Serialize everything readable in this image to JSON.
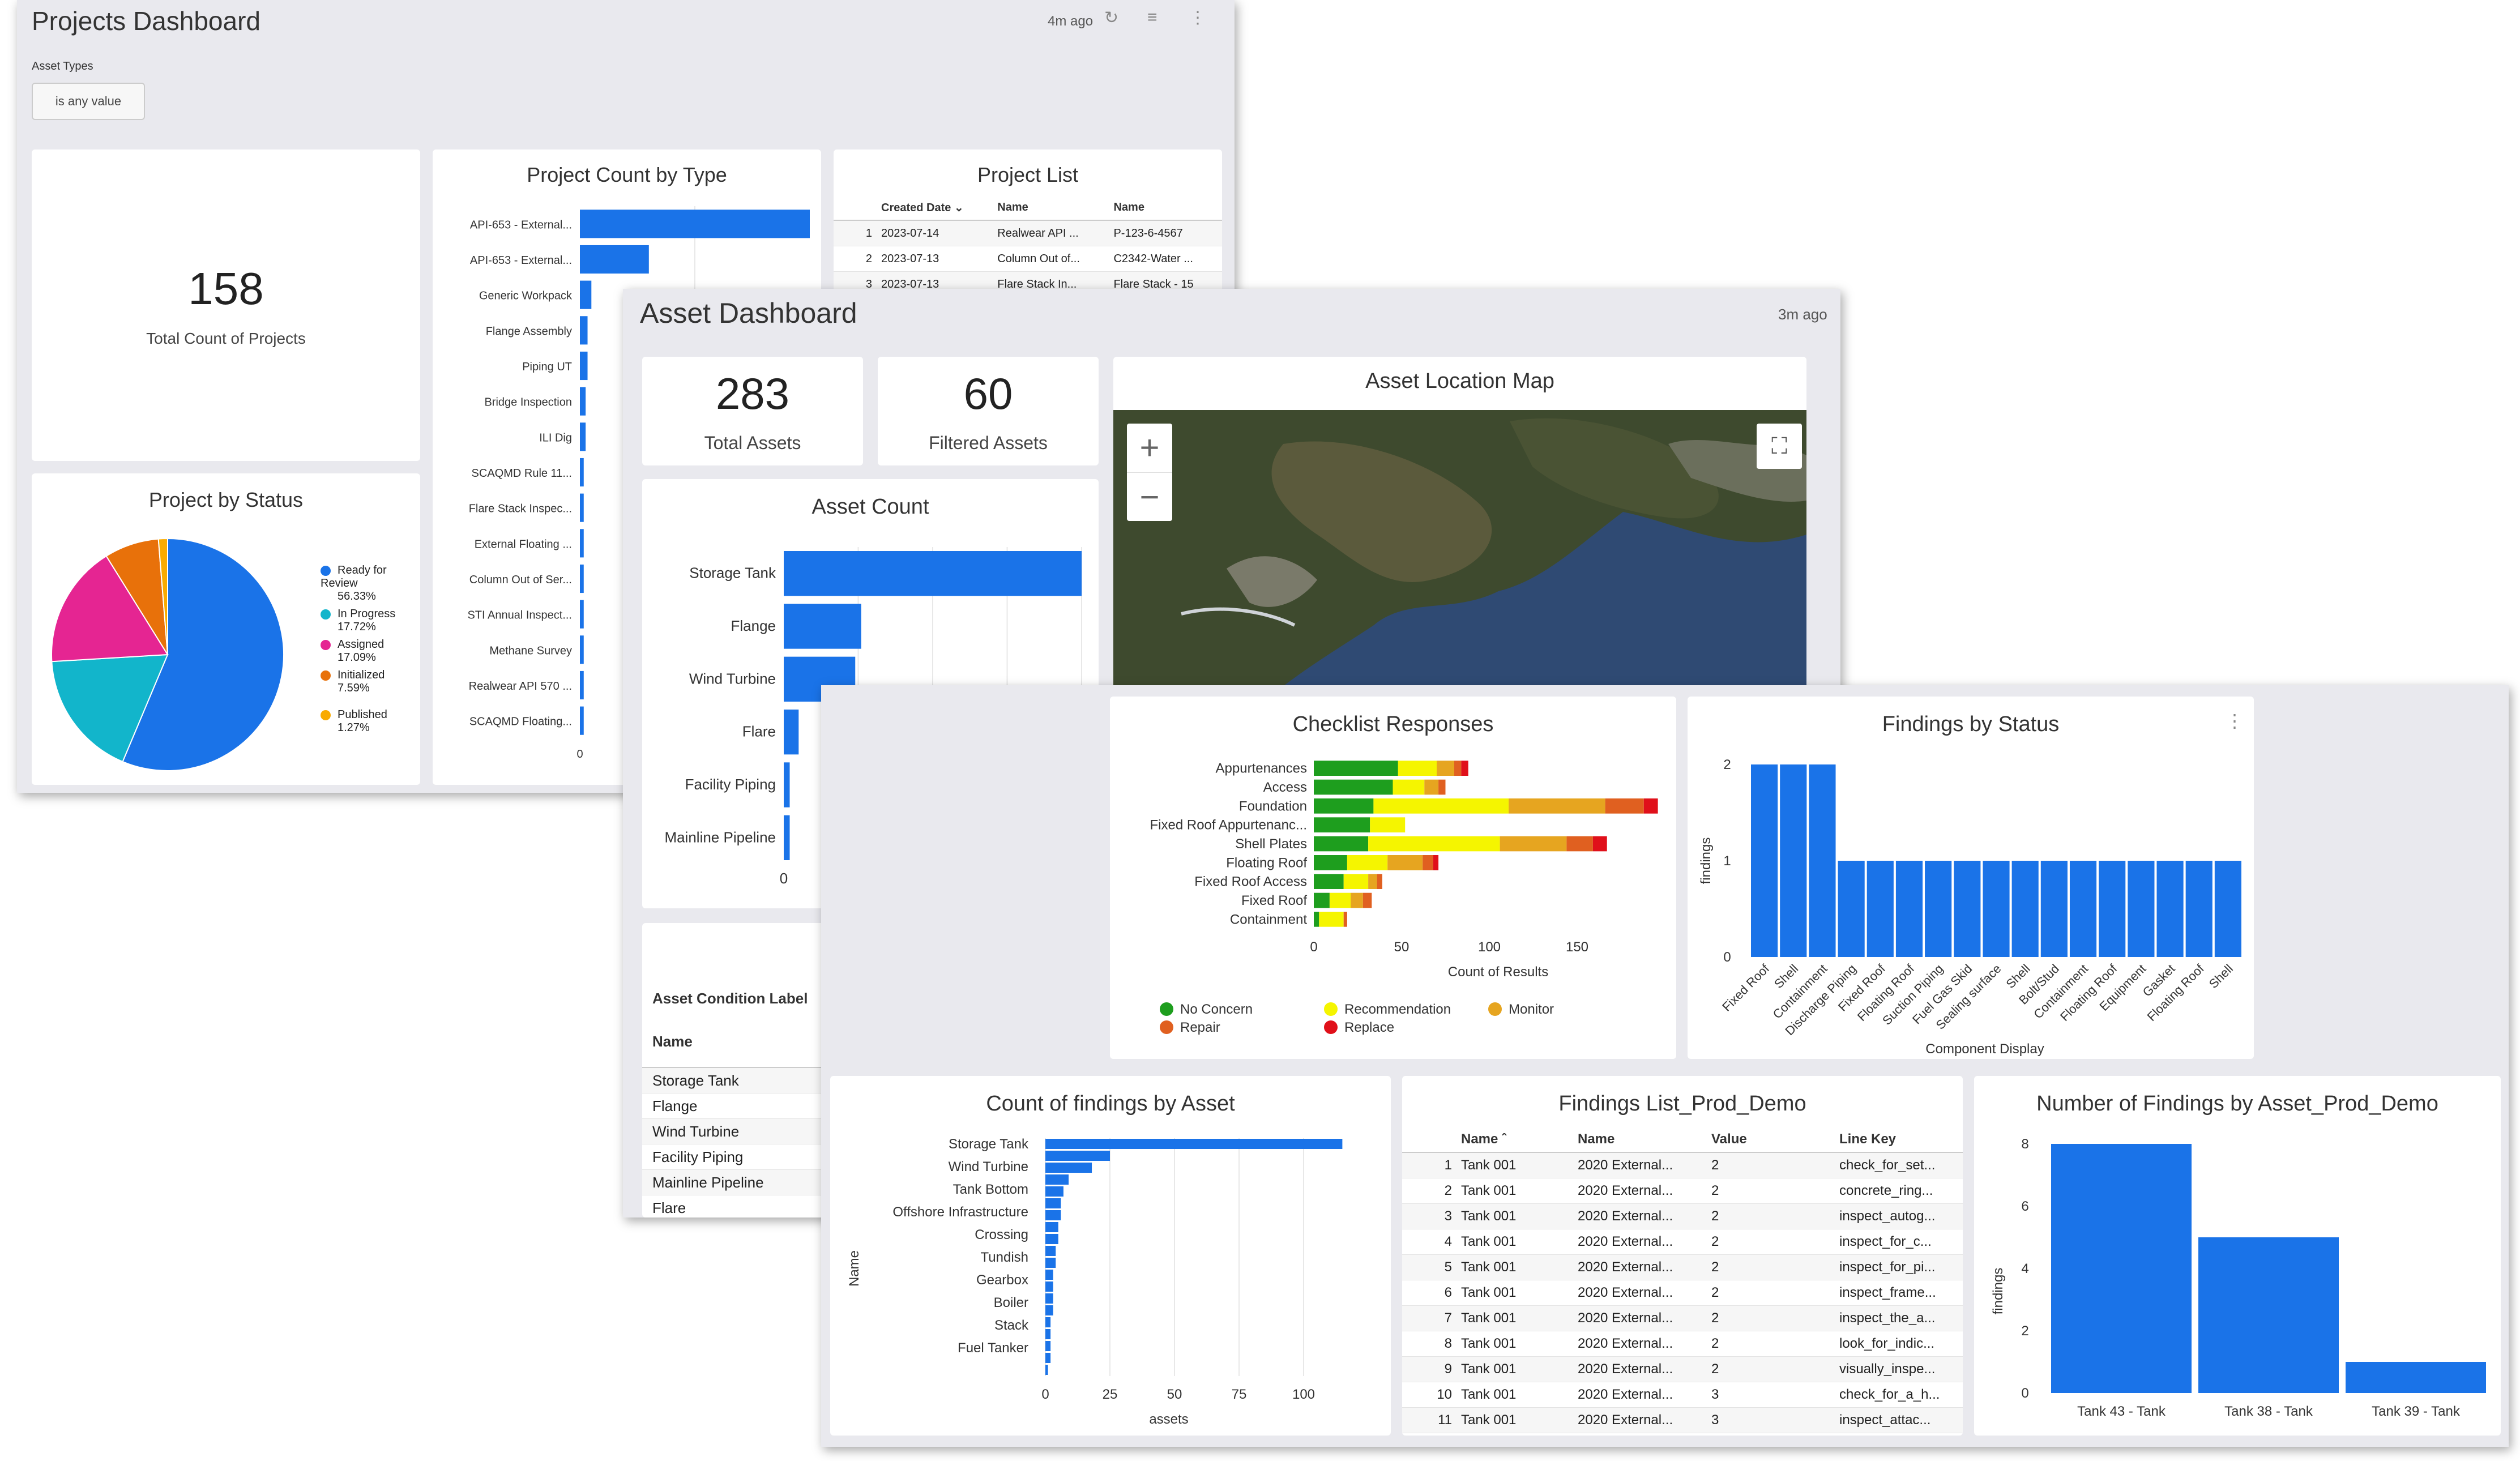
{
  "projects": {
    "title": "Projects Dashboard",
    "updated": "4m ago",
    "filter_label": "Asset Types",
    "filter_value": "is any value",
    "total_count": "158",
    "total_label": "Total Count of Projects",
    "count_by_type": {
      "title": "Project Count by Type",
      "categories": [
        "API-653 - External...",
        "API-653 - External...",
        "Generic Workpack",
        "Flange Assembly",
        "Piping UT",
        "Bridge Inspection",
        "ILI Dig",
        "SCAQMD Rule 11...",
        "Flare Stack Inspec...",
        "External Floating ...",
        "Column Out of Ser...",
        "STI Annual Inspect...",
        "Methane Survey",
        "Realwear API 570 ...",
        "SCAQMD Floating..."
      ],
      "values": [
        60,
        18,
        3,
        2,
        2,
        1.5,
        1.5,
        1,
        1,
        1,
        1,
        1,
        1,
        1,
        1
      ],
      "x_tick": "0"
    },
    "project_list": {
      "title": "Project List",
      "headers": [
        "Created Date",
        "Name",
        "Name"
      ],
      "rows": [
        [
          "1",
          "2023-07-14",
          "Realwear API ...",
          "P-123-6-4567"
        ],
        [
          "2",
          "2023-07-13",
          "Column Out of...",
          "C2342-Water ..."
        ],
        [
          "3",
          "2023-07-13",
          "Flare Stack In...",
          "Flare Stack - 15"
        ]
      ]
    },
    "by_status": {
      "title": "Project by Status",
      "legend": [
        {
          "label": "Ready for Review",
          "pct": "56.33%",
          "color": "#1a73e8",
          "value": 56.33
        },
        {
          "label": "In Progress",
          "pct": "17.72%",
          "color": "#12b5cb",
          "value": 17.72
        },
        {
          "label": "Assigned",
          "pct": "17.09%",
          "color": "#e52592",
          "value": 17.09
        },
        {
          "label": "Initialized",
          "pct": "7.59%",
          "color": "#e8710a",
          "value": 7.59
        },
        {
          "label": "Published",
          "pct": "1.27%",
          "color": "#f9ab00",
          "value": 1.27
        }
      ]
    }
  },
  "asset": {
    "title": "Asset Dashboard",
    "updated": "3m ago",
    "total_assets": "283",
    "total_assets_label": "Total Assets",
    "filtered_assets": "60",
    "filtered_assets_label": "Filtered Assets",
    "map_title": "Asset Location Map",
    "map_zoom_in": "+",
    "map_zoom_out": "−",
    "asset_count": {
      "title": "Asset Count",
      "categories": [
        "Storage Tank",
        "Flange",
        "Wind Turbine",
        "Flare",
        "Facility Piping",
        "Mainline Pipeline"
      ],
      "values": [
        100,
        26,
        24,
        5,
        2,
        2
      ],
      "x_tick": "0"
    },
    "condition": {
      "title": "Asset Condition Label",
      "header": "Name",
      "rows": [
        "Storage Tank",
        "Flange",
        "Wind Turbine",
        "Facility Piping",
        "Mainline Pipeline",
        "Flare"
      ]
    }
  },
  "findings": {
    "checklist": {
      "title": "Checklist Responses",
      "xlabel": "Count of Results",
      "categories": [
        "Appurtenances",
        "Access",
        "Foundation",
        "Fixed Roof Appurtenanc...",
        "Shell Plates",
        "Floating Roof",
        "Fixed Roof Access",
        "Fixed Roof",
        "Containment"
      ],
      "series": [
        {
          "name": "No Concern",
          "color": "#1e9e1e",
          "values": [
            48,
            45,
            34,
            32,
            31,
            19,
            17,
            9,
            3
          ]
        },
        {
          "name": "Recommendation",
          "color": "#f5f500",
          "values": [
            22,
            18,
            77,
            20,
            75,
            23,
            14,
            12,
            14
          ]
        },
        {
          "name": "Monitor",
          "color": "#e6a520",
          "values": [
            10,
            8,
            55,
            0,
            38,
            20,
            5,
            7,
            0
          ]
        },
        {
          "name": "Repair",
          "color": "#e06020",
          "values": [
            4,
            4,
            22,
            0,
            15,
            6,
            3,
            5,
            2
          ]
        },
        {
          "name": "Replace",
          "color": "#e0101a",
          "values": [
            4,
            0,
            8,
            0,
            8,
            3,
            0,
            0,
            0
          ]
        }
      ],
      "ticks": [
        "0",
        "50",
        "100",
        "150"
      ],
      "xmax": 200
    },
    "by_status": {
      "title": "Findings by Status",
      "ylabel": "findings",
      "xlabel": "Component Display",
      "categories": [
        "Fixed Roof",
        "Shell",
        "Containment",
        "Discharge Piping",
        "Fixed Roof",
        "Floating Roof",
        "Suction Piping",
        "Fuel Gas Skid",
        "Sealing surface",
        "Shell",
        "Bolt/Stud",
        "Containment",
        "Floating Roof",
        "Equipment",
        "Gasket",
        "Floating Roof",
        "Shell"
      ],
      "values": [
        2,
        2,
        2,
        1,
        1,
        1,
        1,
        1,
        1,
        1,
        1,
        1,
        1,
        1,
        1,
        1,
        1
      ],
      "yticks": [
        "0",
        "1",
        "2"
      ],
      "ymax": 2
    },
    "by_asset": {
      "title": "Count of findings by Asset",
      "ylabel": "Name",
      "xlabel": "assets",
      "labels": [
        "Storage Tank",
        "Wind Turbine",
        "Tank Bottom",
        "Offshore Infrastructure",
        "Crossing",
        "Tundish",
        "Gearbox",
        "Boiler",
        "Stack",
        "Fuel Tanker"
      ],
      "values": [
        115,
        25,
        18,
        9,
        7,
        6,
        6,
        5,
        5,
        4,
        4,
        3,
        3,
        3,
        3,
        2,
        2,
        2,
        2,
        1
      ],
      "ticks": [
        "0",
        "25",
        "50",
        "75",
        "100"
      ],
      "xmax": 125
    },
    "list": {
      "title": "Findings List_Prod_Demo",
      "headers": [
        "Name",
        "Name",
        "Value",
        "Line Key"
      ],
      "rows": [
        [
          "1",
          "Tank 001",
          "2020 External...",
          "2",
          "check_for_set..."
        ],
        [
          "2",
          "Tank 001",
          "2020 External...",
          "2",
          "concrete_ring..."
        ],
        [
          "3",
          "Tank 001",
          "2020 External...",
          "2",
          "inspect_autog..."
        ],
        [
          "4",
          "Tank 001",
          "2020 External...",
          "2",
          "inspect_for_c..."
        ],
        [
          "5",
          "Tank 001",
          "2020 External...",
          "2",
          "inspect_for_pi..."
        ],
        [
          "6",
          "Tank 001",
          "2020 External...",
          "2",
          "inspect_frame..."
        ],
        [
          "7",
          "Tank 001",
          "2020 External...",
          "2",
          "inspect_the_a..."
        ],
        [
          "8",
          "Tank 001",
          "2020 External...",
          "2",
          "look_for_indic..."
        ],
        [
          "9",
          "Tank 001",
          "2020 External...",
          "2",
          "visually_inspe..."
        ],
        [
          "10",
          "Tank 001",
          "2020 External...",
          "3",
          "check_for_a_h..."
        ],
        [
          "11",
          "Tank 001",
          "2020 External...",
          "3",
          "inspect_attac..."
        ]
      ]
    },
    "num_by_asset": {
      "title": "Number of Findings by Asset_Prod_Demo",
      "ylabel": "findings",
      "categories": [
        "Tank 43 - Tank",
        "Tank 38 - Tank",
        "Tank 39 - Tank"
      ],
      "values": [
        8,
        5,
        1
      ],
      "yticks": [
        "0",
        "2",
        "4",
        "6",
        "8"
      ],
      "ymax": 8
    }
  }
}
